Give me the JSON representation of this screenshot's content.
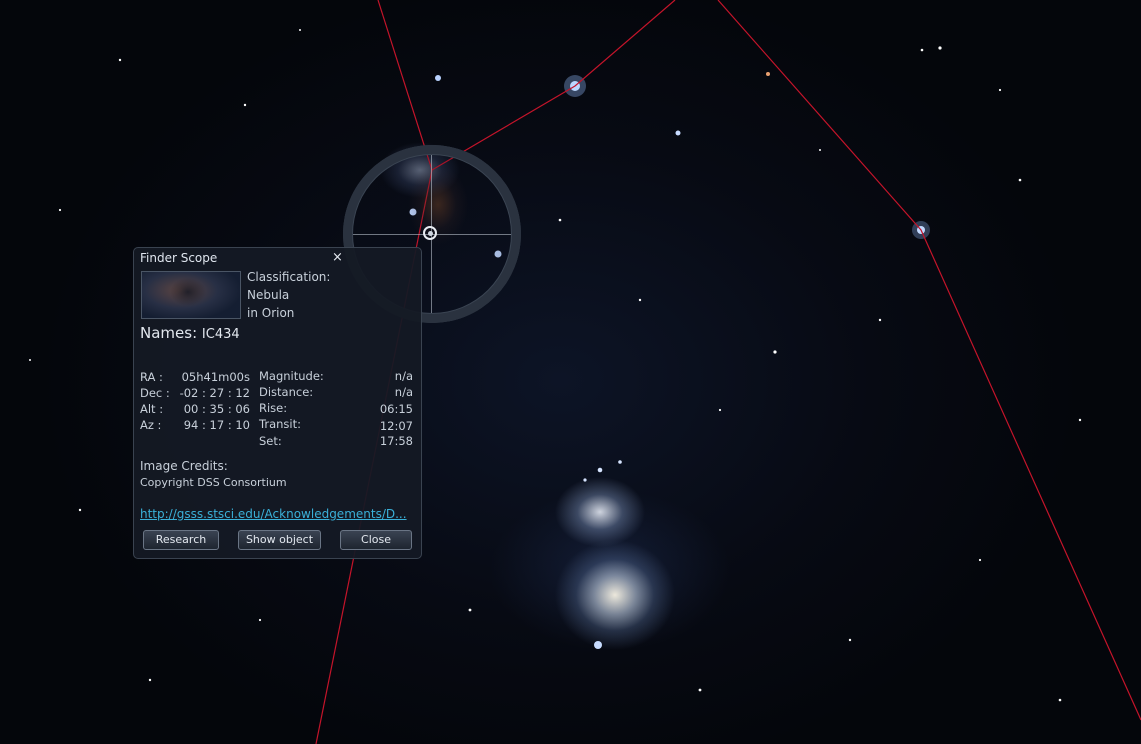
{
  "panel": {
    "title": "Finder Scope",
    "close_glyph": "×",
    "thumbnail": "object-thumbnail-image",
    "classification_label": "Classification:",
    "classification_type": "Nebula",
    "classification_location": "in Orion",
    "names_label": "Names:",
    "names_value": "IC434",
    "coords": [
      {
        "label": "RA :",
        "value": "05h41m00s"
      },
      {
        "label": "Dec :",
        "value": "-02 : 27 : 12"
      },
      {
        "label": "Alt :",
        "value": "00 : 35 : 06"
      },
      {
        "label": "Az :",
        "value": "94 : 17 : 10"
      }
    ],
    "props": [
      {
        "label": "Magnitude:",
        "value": "n/a"
      },
      {
        "label": "Distance:",
        "value": "n/a"
      },
      {
        "label": "Rise:",
        "value": "06:15"
      },
      {
        "label": "Transit:",
        "value": "12:07"
      },
      {
        "label": "Set:",
        "value": "17:58"
      }
    ],
    "credits_label": "Image Credits:",
    "credits_value": "Copyright DSS Consortium",
    "link": "http://gsss.stsci.edu/Acknowledgements/D...",
    "buttons": {
      "research": "Research",
      "show_object": "Show object",
      "close": "Close"
    }
  },
  "colors": {
    "constellation_line": "#c4142a",
    "link": "#3ab0d8",
    "panel_bg": "#141a24"
  },
  "icons": {
    "close": "close-icon",
    "crosshair": "crosshair-icon"
  }
}
